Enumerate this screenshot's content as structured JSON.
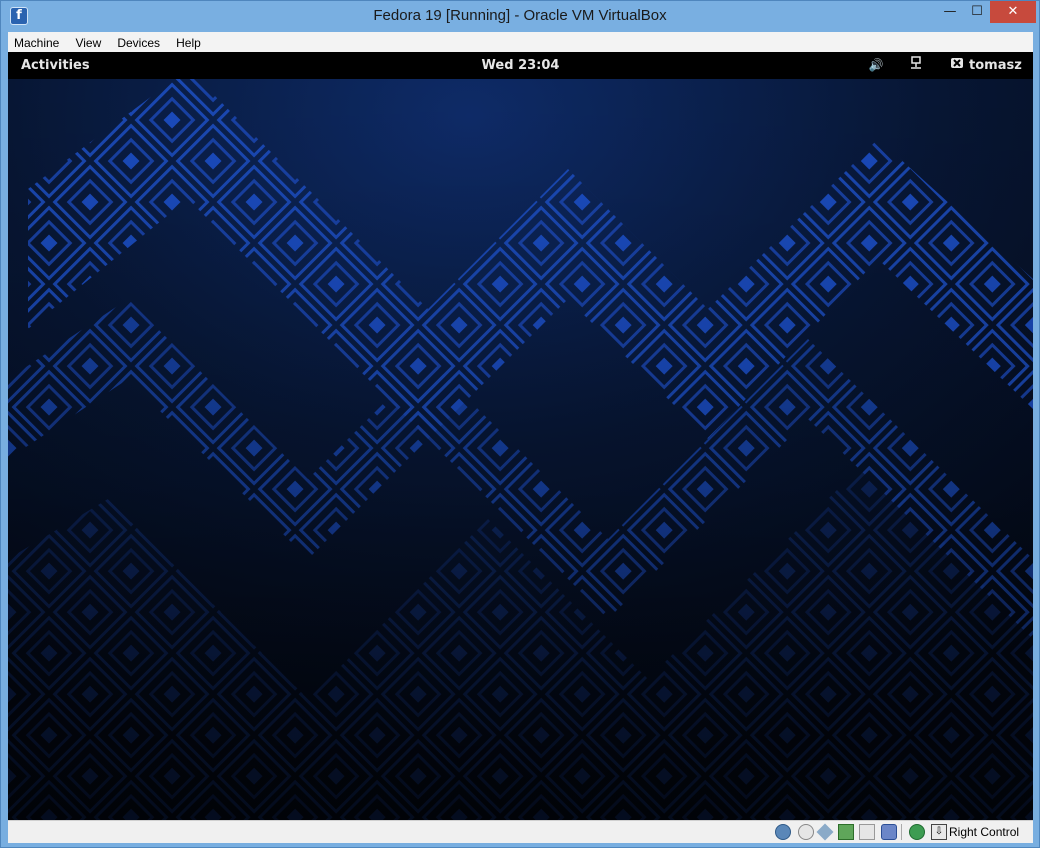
{
  "window": {
    "title": "Fedora 19 [Running] - Oracle VM VirtualBox",
    "icon": "virtualbox-app-icon",
    "controls": {
      "minimize": "—",
      "maximize": "☐",
      "close": "✕"
    }
  },
  "menubar": {
    "items": [
      {
        "label": "Machine"
      },
      {
        "label": "View"
      },
      {
        "label": "Devices"
      },
      {
        "label": "Help"
      }
    ]
  },
  "guest": {
    "topbar": {
      "activities": "Activities",
      "clock": "Wed 23:04",
      "volume_icon": "volume-icon",
      "network_icon": "network-wired-icon",
      "user_icon": "user-status-icon",
      "username": "tomasz"
    },
    "wallpaper": {
      "base_color": "#050a1a",
      "accent_color": "#1846b8"
    }
  },
  "statusbar": {
    "icons": [
      "hard-disk-icon",
      "optical-drive-icon",
      "usb-icon",
      "network-icon",
      "shared-folders-icon",
      "video-capture-icon",
      "mouse-integration-icon",
      "keyboard-capture-icon"
    ],
    "host_key": "Right Control"
  }
}
